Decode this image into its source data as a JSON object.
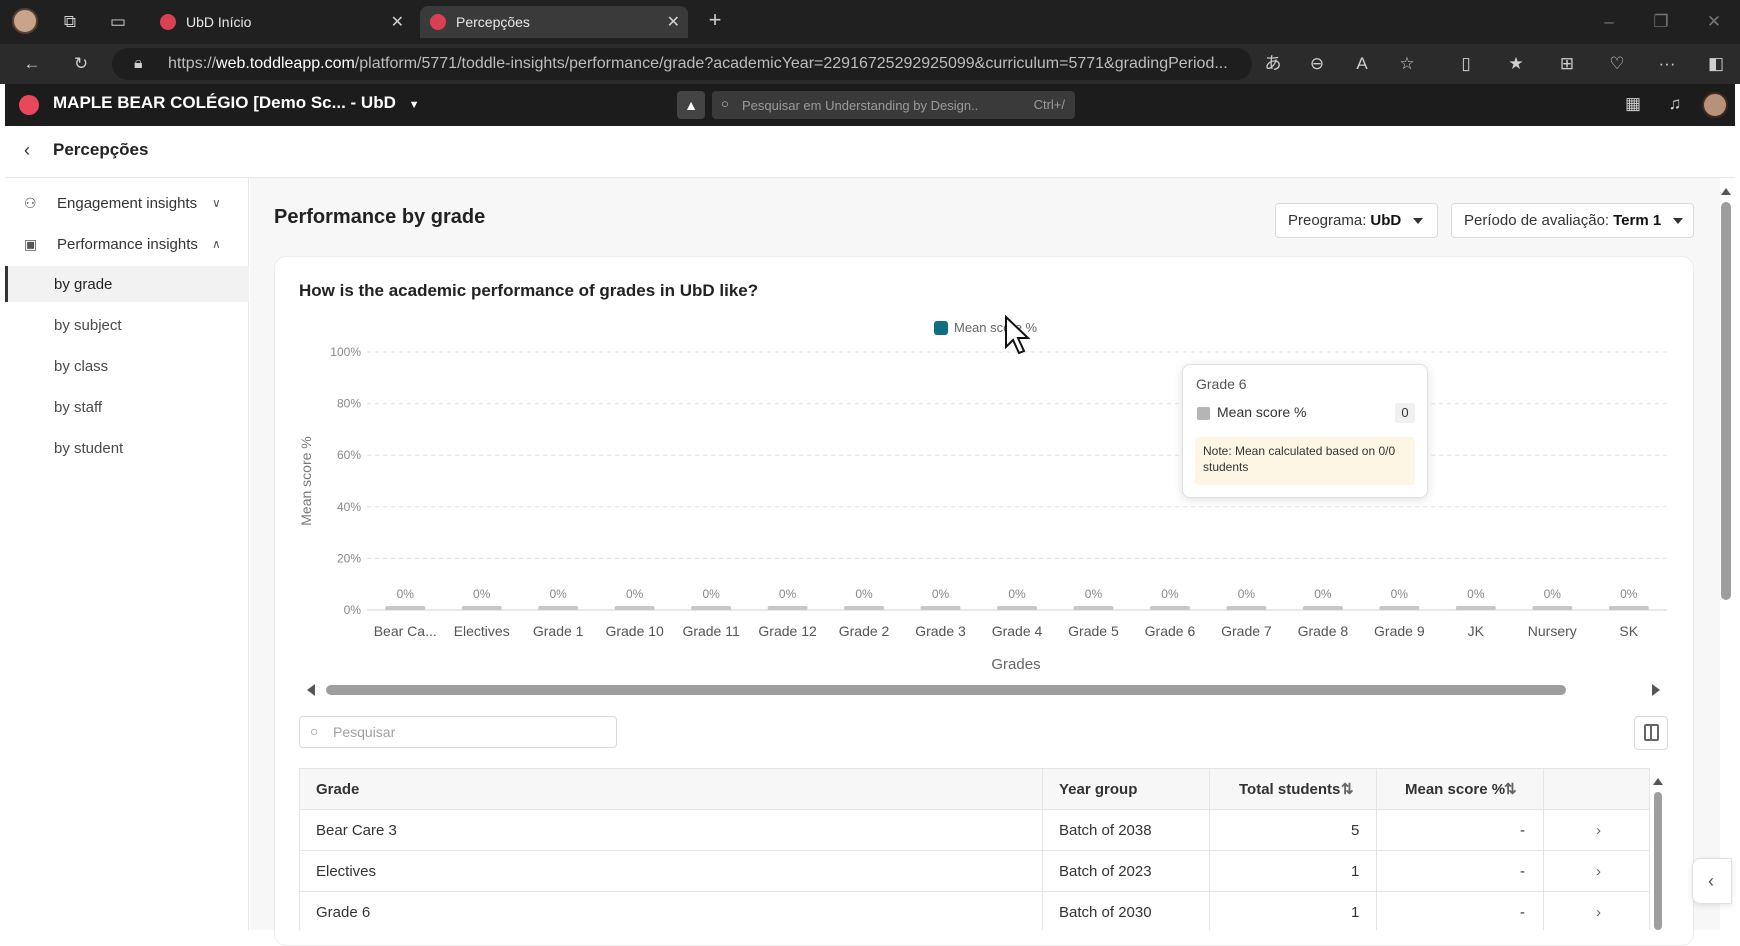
{
  "browser": {
    "tabs": [
      {
        "title": "UbD Início"
      },
      {
        "title": "Percepções"
      }
    ],
    "url_prefix": "https://",
    "url_host": "web.toddleapp.com",
    "url_rest": "/platform/5771/toddle-insights/performance/grade?academicYear=22916725292925099&curriculum=5771&gradingPeriod..."
  },
  "app": {
    "school": "MAPLE BEAR COLÉGIO [Demo Sc... - UbD",
    "search_placeholder": "Pesquisar em Understanding by Design..",
    "search_shortcut": "Ctrl+/"
  },
  "page": {
    "back_title": "Percepções",
    "title": "Performance by grade",
    "program_label": "Preograma:",
    "program_value": "UbD",
    "period_label": "Período de avaliação:",
    "period_value": "Term 1"
  },
  "sidebar": {
    "engagement": "Engagement insights",
    "performance": "Performance insights",
    "items": [
      "by grade",
      "by subject",
      "by class",
      "by staff",
      "by student"
    ]
  },
  "chart_data": {
    "type": "bar",
    "title": "How is the academic performance of grades in UbD like?",
    "xlabel": "Grades",
    "ylabel": "Mean score %",
    "ylim": [
      0,
      100
    ],
    "yticks": [
      "0%",
      "20%",
      "40%",
      "60%",
      "80%",
      "100%"
    ],
    "legend": "top",
    "categories": [
      "Bear Ca...",
      "Electives",
      "Grade 1",
      "Grade 10",
      "Grade 11",
      "Grade 12",
      "Grade 2",
      "Grade 3",
      "Grade 4",
      "Grade 5",
      "Grade 6",
      "Grade 7",
      "Grade 8",
      "Grade 9",
      "JK",
      "Nursery",
      "SK"
    ],
    "series": [
      {
        "name": "Mean score %",
        "values": [
          0,
          0,
          0,
          0,
          0,
          0,
          0,
          0,
          0,
          0,
          0,
          0,
          0,
          0,
          0,
          0,
          0
        ],
        "data_labels": [
          "0%",
          "0%",
          "0%",
          "0%",
          "0%",
          "0%",
          "0%",
          "0%",
          "0%",
          "0%",
          "0%",
          "0%",
          "0%",
          "0%",
          "0%",
          "0%",
          "0%"
        ]
      }
    ],
    "colors": {
      "legend": "#0f6e7f",
      "bar": "#c7c7c7",
      "grid": "#e3e3e3"
    },
    "tooltip": {
      "title": "Grade 6",
      "label": "Mean score %",
      "value": "0",
      "note": "Note: Mean calculated based on 0/0 students"
    }
  },
  "table": {
    "search_placeholder": "Pesquisar",
    "headers": [
      "Grade",
      "Year group",
      "Total students",
      "Mean score %"
    ],
    "rows": [
      {
        "grade": "Bear Care 3",
        "year_group": "Batch of 2038",
        "total": "5",
        "mean": "-"
      },
      {
        "grade": "Electives",
        "year_group": "Batch of 2023",
        "total": "1",
        "mean": "-"
      },
      {
        "grade": "Grade 6",
        "year_group": "Batch of 2030",
        "total": "1",
        "mean": "-"
      }
    ]
  }
}
